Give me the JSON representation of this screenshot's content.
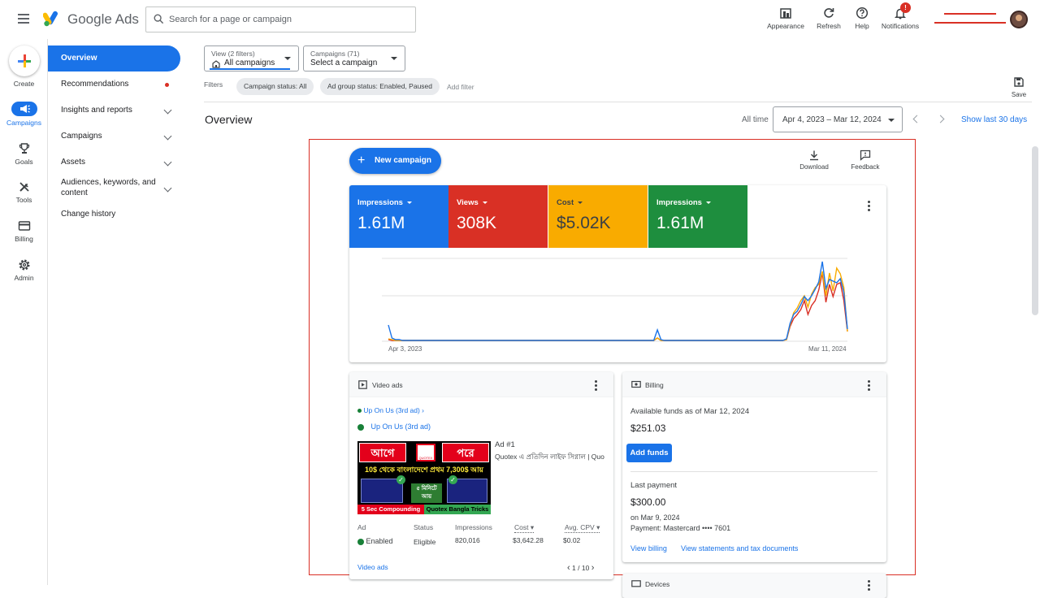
{
  "app": {
    "brand": "Google Ads"
  },
  "search": {
    "placeholder": "Search for a page or campaign"
  },
  "toolbar": {
    "appearance": "Appearance",
    "refresh": "Refresh",
    "help": "Help",
    "notifications": "Notifications",
    "notification_badge": "!"
  },
  "rail": {
    "create": "Create",
    "campaigns": "Campaigns",
    "goals": "Goals",
    "tools": "Tools",
    "billing": "Billing",
    "admin": "Admin"
  },
  "sidenav": {
    "items": [
      {
        "label": "Overview"
      },
      {
        "label": "Recommendations"
      },
      {
        "label": "Insights and reports"
      },
      {
        "label": "Campaigns"
      },
      {
        "label": "Assets"
      },
      {
        "label": "Audiences, keywords, and content"
      },
      {
        "label": "Change history"
      }
    ]
  },
  "view_selector": {
    "small": "View (2 filters)",
    "value": "All campaigns"
  },
  "campaign_selector": {
    "small": "Campaigns (71)",
    "value": "Select a campaign"
  },
  "filters": {
    "label": "Filters",
    "chips": [
      "Campaign status: All",
      "Ad group status: Enabled, Paused"
    ],
    "add": "Add filter"
  },
  "save_label": "Save",
  "page": {
    "title": "Overview",
    "all_time": "All time",
    "date_range": "Apr 4, 2023 – Mar 12, 2024",
    "show_last": "Show last 30 days"
  },
  "actions": {
    "new_campaign": "New campaign",
    "download": "Download",
    "feedback": "Feedback"
  },
  "colors": {
    "blue": "#1a73e8",
    "red": "#d93025",
    "yellow": "#f9ab00",
    "green": "#1e8e3e"
  },
  "kpis": [
    {
      "label": "Impressions",
      "value": "1.61M",
      "color": "#1a73e8"
    },
    {
      "label": "Views",
      "value": "308K",
      "color": "#d93025"
    },
    {
      "label": "Cost",
      "value": "$5.02K",
      "color": "#f9ab00"
    },
    {
      "label": "Impressions",
      "value": "1.61M",
      "color": "#1e8e3e"
    }
  ],
  "chart_data": {
    "type": "line",
    "x_start_label": "Apr 3, 2023",
    "x_end_label": "Mar 11, 2024",
    "ylim": [
      0,
      1
    ],
    "series": [
      {
        "name": "Impressions",
        "color": "#1a73e8",
        "values": [
          0.2,
          0.04,
          0.02,
          0.02,
          0.01,
          0.01,
          0.01,
          0.01,
          0.01,
          0.01,
          0.01,
          0.01,
          0.01,
          0.01,
          0.01,
          0.01,
          0.01,
          0.01,
          0.01,
          0.01,
          0.01,
          0.01,
          0.01,
          0.01,
          0.01,
          0.01,
          0.01,
          0.01,
          0.01,
          0.01,
          0.01,
          0.01,
          0.01,
          0.01,
          0.01,
          0.01,
          0.01,
          0.01,
          0.01,
          0.01,
          0.01,
          0.01,
          0.01,
          0.01,
          0.01,
          0.01,
          0.01,
          0.01,
          0.01,
          0.01,
          0.01,
          0.01,
          0.01,
          0.01,
          0.01,
          0.01,
          0.01,
          0.01,
          0.01,
          0.01,
          0.01,
          0.01,
          0.01,
          0.01,
          0.01,
          0.01,
          0.01,
          0.01,
          0.01,
          0.01,
          0.01,
          0.01,
          0.01,
          0.01,
          0.01,
          0.14,
          0.02,
          0.01,
          0.01,
          0.01,
          0.01,
          0.01,
          0.01,
          0.01,
          0.01,
          0.01,
          0.01,
          0.01,
          0.01,
          0.01,
          0.01,
          0.01,
          0.01,
          0.01,
          0.01,
          0.01,
          0.01,
          0.01,
          0.01,
          0.01,
          0.01,
          0.01,
          0.01,
          0.01,
          0.01,
          0.01,
          0.01,
          0.01,
          0.01,
          0.01,
          0.01,
          0.03,
          0.22,
          0.33,
          0.37,
          0.45,
          0.55,
          0.5,
          0.56,
          0.64,
          0.73,
          0.98,
          0.65,
          0.76,
          0.74,
          0.72,
          0.77,
          0.6,
          0.15
        ]
      },
      {
        "name": "Views",
        "color": "#d93025",
        "values": [
          0.02,
          0.01,
          0.01,
          0.01,
          0.01,
          0.01,
          0.01,
          0.01,
          0.01,
          0.01,
          0.01,
          0.01,
          0.01,
          0.01,
          0.01,
          0.01,
          0.01,
          0.01,
          0.01,
          0.01,
          0.01,
          0.01,
          0.01,
          0.01,
          0.01,
          0.01,
          0.01,
          0.01,
          0.01,
          0.01,
          0.01,
          0.01,
          0.01,
          0.01,
          0.01,
          0.01,
          0.01,
          0.01,
          0.01,
          0.01,
          0.01,
          0.01,
          0.01,
          0.01,
          0.01,
          0.01,
          0.01,
          0.01,
          0.01,
          0.01,
          0.01,
          0.01,
          0.01,
          0.01,
          0.01,
          0.01,
          0.01,
          0.01,
          0.01,
          0.01,
          0.01,
          0.01,
          0.01,
          0.01,
          0.01,
          0.01,
          0.01,
          0.01,
          0.01,
          0.01,
          0.01,
          0.01,
          0.01,
          0.01,
          0.01,
          0.04,
          0.01,
          0.01,
          0.01,
          0.01,
          0.01,
          0.01,
          0.01,
          0.01,
          0.01,
          0.01,
          0.01,
          0.01,
          0.01,
          0.01,
          0.01,
          0.01,
          0.01,
          0.01,
          0.01,
          0.01,
          0.01,
          0.01,
          0.01,
          0.01,
          0.01,
          0.01,
          0.01,
          0.01,
          0.01,
          0.01,
          0.01,
          0.01,
          0.01,
          0.01,
          0.01,
          0.02,
          0.18,
          0.28,
          0.33,
          0.39,
          0.5,
          0.33,
          0.44,
          0.5,
          0.63,
          0.84,
          0.48,
          0.7,
          0.55,
          0.7,
          0.72,
          0.5,
          0.12
        ]
      },
      {
        "name": "Cost",
        "color": "#f9ab00",
        "values": [
          0.03,
          0.02,
          0.01,
          0.01,
          0.01,
          0.01,
          0.01,
          0.01,
          0.01,
          0.01,
          0.01,
          0.01,
          0.01,
          0.01,
          0.01,
          0.01,
          0.01,
          0.01,
          0.01,
          0.01,
          0.01,
          0.01,
          0.01,
          0.01,
          0.01,
          0.01,
          0.01,
          0.01,
          0.01,
          0.01,
          0.01,
          0.01,
          0.01,
          0.01,
          0.01,
          0.01,
          0.01,
          0.01,
          0.01,
          0.01,
          0.01,
          0.01,
          0.01,
          0.01,
          0.01,
          0.01,
          0.01,
          0.01,
          0.01,
          0.01,
          0.01,
          0.01,
          0.01,
          0.01,
          0.01,
          0.01,
          0.01,
          0.01,
          0.01,
          0.01,
          0.01,
          0.01,
          0.01,
          0.01,
          0.01,
          0.01,
          0.01,
          0.01,
          0.01,
          0.01,
          0.01,
          0.01,
          0.01,
          0.01,
          0.01,
          0.04,
          0.01,
          0.01,
          0.01,
          0.01,
          0.01,
          0.01,
          0.01,
          0.01,
          0.01,
          0.01,
          0.01,
          0.01,
          0.01,
          0.01,
          0.01,
          0.01,
          0.01,
          0.01,
          0.01,
          0.01,
          0.01,
          0.01,
          0.01,
          0.01,
          0.01,
          0.01,
          0.01,
          0.01,
          0.01,
          0.01,
          0.01,
          0.01,
          0.01,
          0.01,
          0.01,
          0.02,
          0.2,
          0.35,
          0.41,
          0.5,
          0.56,
          0.42,
          0.58,
          0.66,
          0.7,
          0.86,
          0.56,
          0.84,
          0.62,
          0.9,
          0.83,
          0.66,
          0.12
        ]
      }
    ]
  },
  "video_ads": {
    "title": "Video ads",
    "breadcrumb": "Up On Us (3rd ad) ›",
    "campaign": "Up On Us (3rd ad)",
    "ad_number": "Ad #1",
    "ad_desc": "Quotex এ প্রতিদিন লাইফ সিগ্নাল | Quo",
    "thumb": {
      "left": "আগে",
      "right": "পরে",
      "line2": "10$ থেকে বাংলাদেশে প্রথম 7,300$ আয়",
      "mid": "৫ মিনিটে আয়",
      "bottom_left": "5 Sec Compounding",
      "bottom_right": "Quotex Bangla Tricks",
      "logo": "QUOTEX"
    },
    "headers": [
      "Ad",
      "Status",
      "Impressions",
      "Cost",
      "Avg. CPV"
    ],
    "row": {
      "ad": "Enabled",
      "status": "Eligible",
      "impressions": "820,016",
      "cost": "$3,642.28",
      "cpv": "$0.02"
    },
    "footer_link": "Video ads",
    "pager": "1 / 10"
  },
  "billing": {
    "title": "Billing",
    "available_label": "Available funds as of Mar 12, 2024",
    "available_value": "$251.03",
    "add_funds": "Add funds",
    "last_payment_label": "Last payment",
    "last_payment_value": "$300.00",
    "last_payment_date": "on Mar 9, 2024",
    "payment_method": "Payment: Mastercard •••• 7601",
    "view_billing": "View billing",
    "view_statements": "View statements and tax documents"
  },
  "devices": {
    "title": "Devices"
  }
}
